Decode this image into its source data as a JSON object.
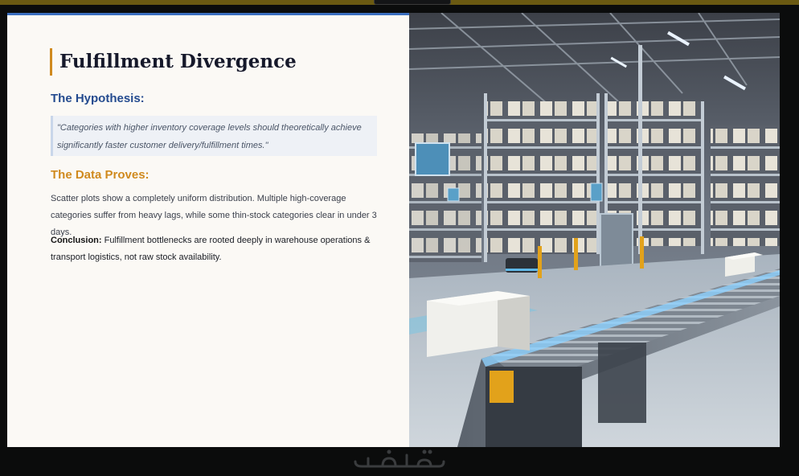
{
  "slide": {
    "title": "Fulfillment Divergence",
    "hypothesis_heading": "The Hypothesis:",
    "hypothesis_quote": "\"Categories with higher inventory coverage levels should theoretically achieve significantly faster customer delivery/fulfillment times.\"",
    "data_heading": "The Data Proves:",
    "data_body": "Scatter plots show a completely uniform distribution. Multiple high-coverage categories suffer from heavy lags, while some thin-stock categories clear in under 3 days.",
    "conclusion_label": "Conclusion:",
    "conclusion_text": " Fulfillment bottlenecks are rooted deeply in warehouse operations & transport logistics, not raw stock availability."
  },
  "image": {
    "subject": "warehouse-conveyor-photo"
  },
  "watermark": {
    "name": "khamsat-logo"
  },
  "colors": {
    "title_accent": "#d08a1e",
    "hypothesis_heading": "#244b8f",
    "data_heading": "#d08a1e",
    "slide_bg": "#fbf9f5",
    "top_accent": "#3b6fbf"
  }
}
